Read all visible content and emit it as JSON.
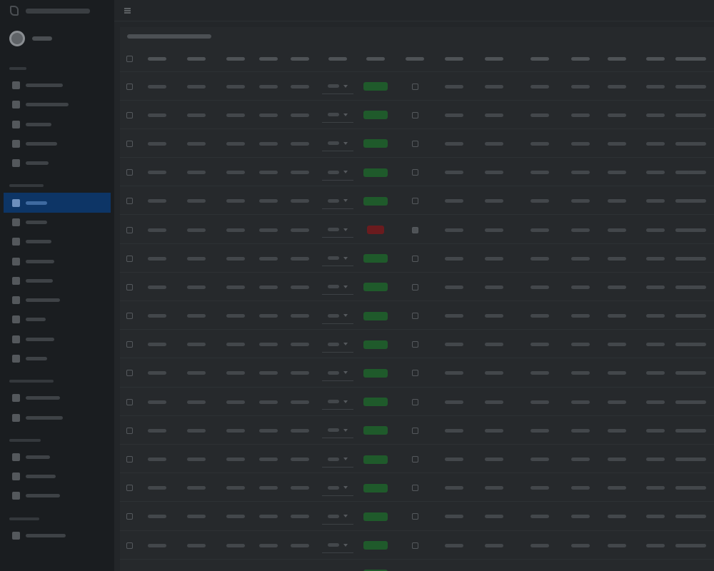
{
  "sidebar": {
    "items": [
      {
        "group": true
      },
      {},
      {},
      {},
      {},
      {},
      {
        "group": true
      },
      {
        "active": true
      },
      {},
      {},
      {},
      {},
      {},
      {},
      {},
      {},
      {
        "group": true
      },
      {},
      {},
      {
        "group": true
      },
      {},
      {},
      {},
      {
        "group": true
      },
      {}
    ]
  },
  "table": {
    "column_count": 18,
    "rows": [
      {
        "status": "green",
        "checked": false
      },
      {
        "status": "green",
        "checked": false
      },
      {
        "status": "green",
        "checked": false
      },
      {
        "status": "green",
        "checked": false
      },
      {
        "status": "green",
        "checked": false
      },
      {
        "status": "red",
        "checked": true
      },
      {
        "status": "green",
        "checked": false
      },
      {
        "status": "green",
        "checked": false
      },
      {
        "status": "green",
        "checked": false
      },
      {
        "status": "green",
        "checked": false
      },
      {
        "status": "green",
        "checked": false
      },
      {
        "status": "green",
        "checked": false
      },
      {
        "status": "green",
        "checked": false
      },
      {
        "status": "green",
        "checked": false
      },
      {
        "status": "green",
        "checked": false
      },
      {
        "status": "green",
        "checked": false
      },
      {
        "status": "green",
        "checked": false
      },
      {
        "status": "green",
        "checked": false
      }
    ]
  },
  "colors": {
    "sidebar_bg": "#1a1d20",
    "active_item_bg": "#0d3566",
    "badge_green": "#1f5a2b",
    "badge_red": "#6a1b1e"
  }
}
